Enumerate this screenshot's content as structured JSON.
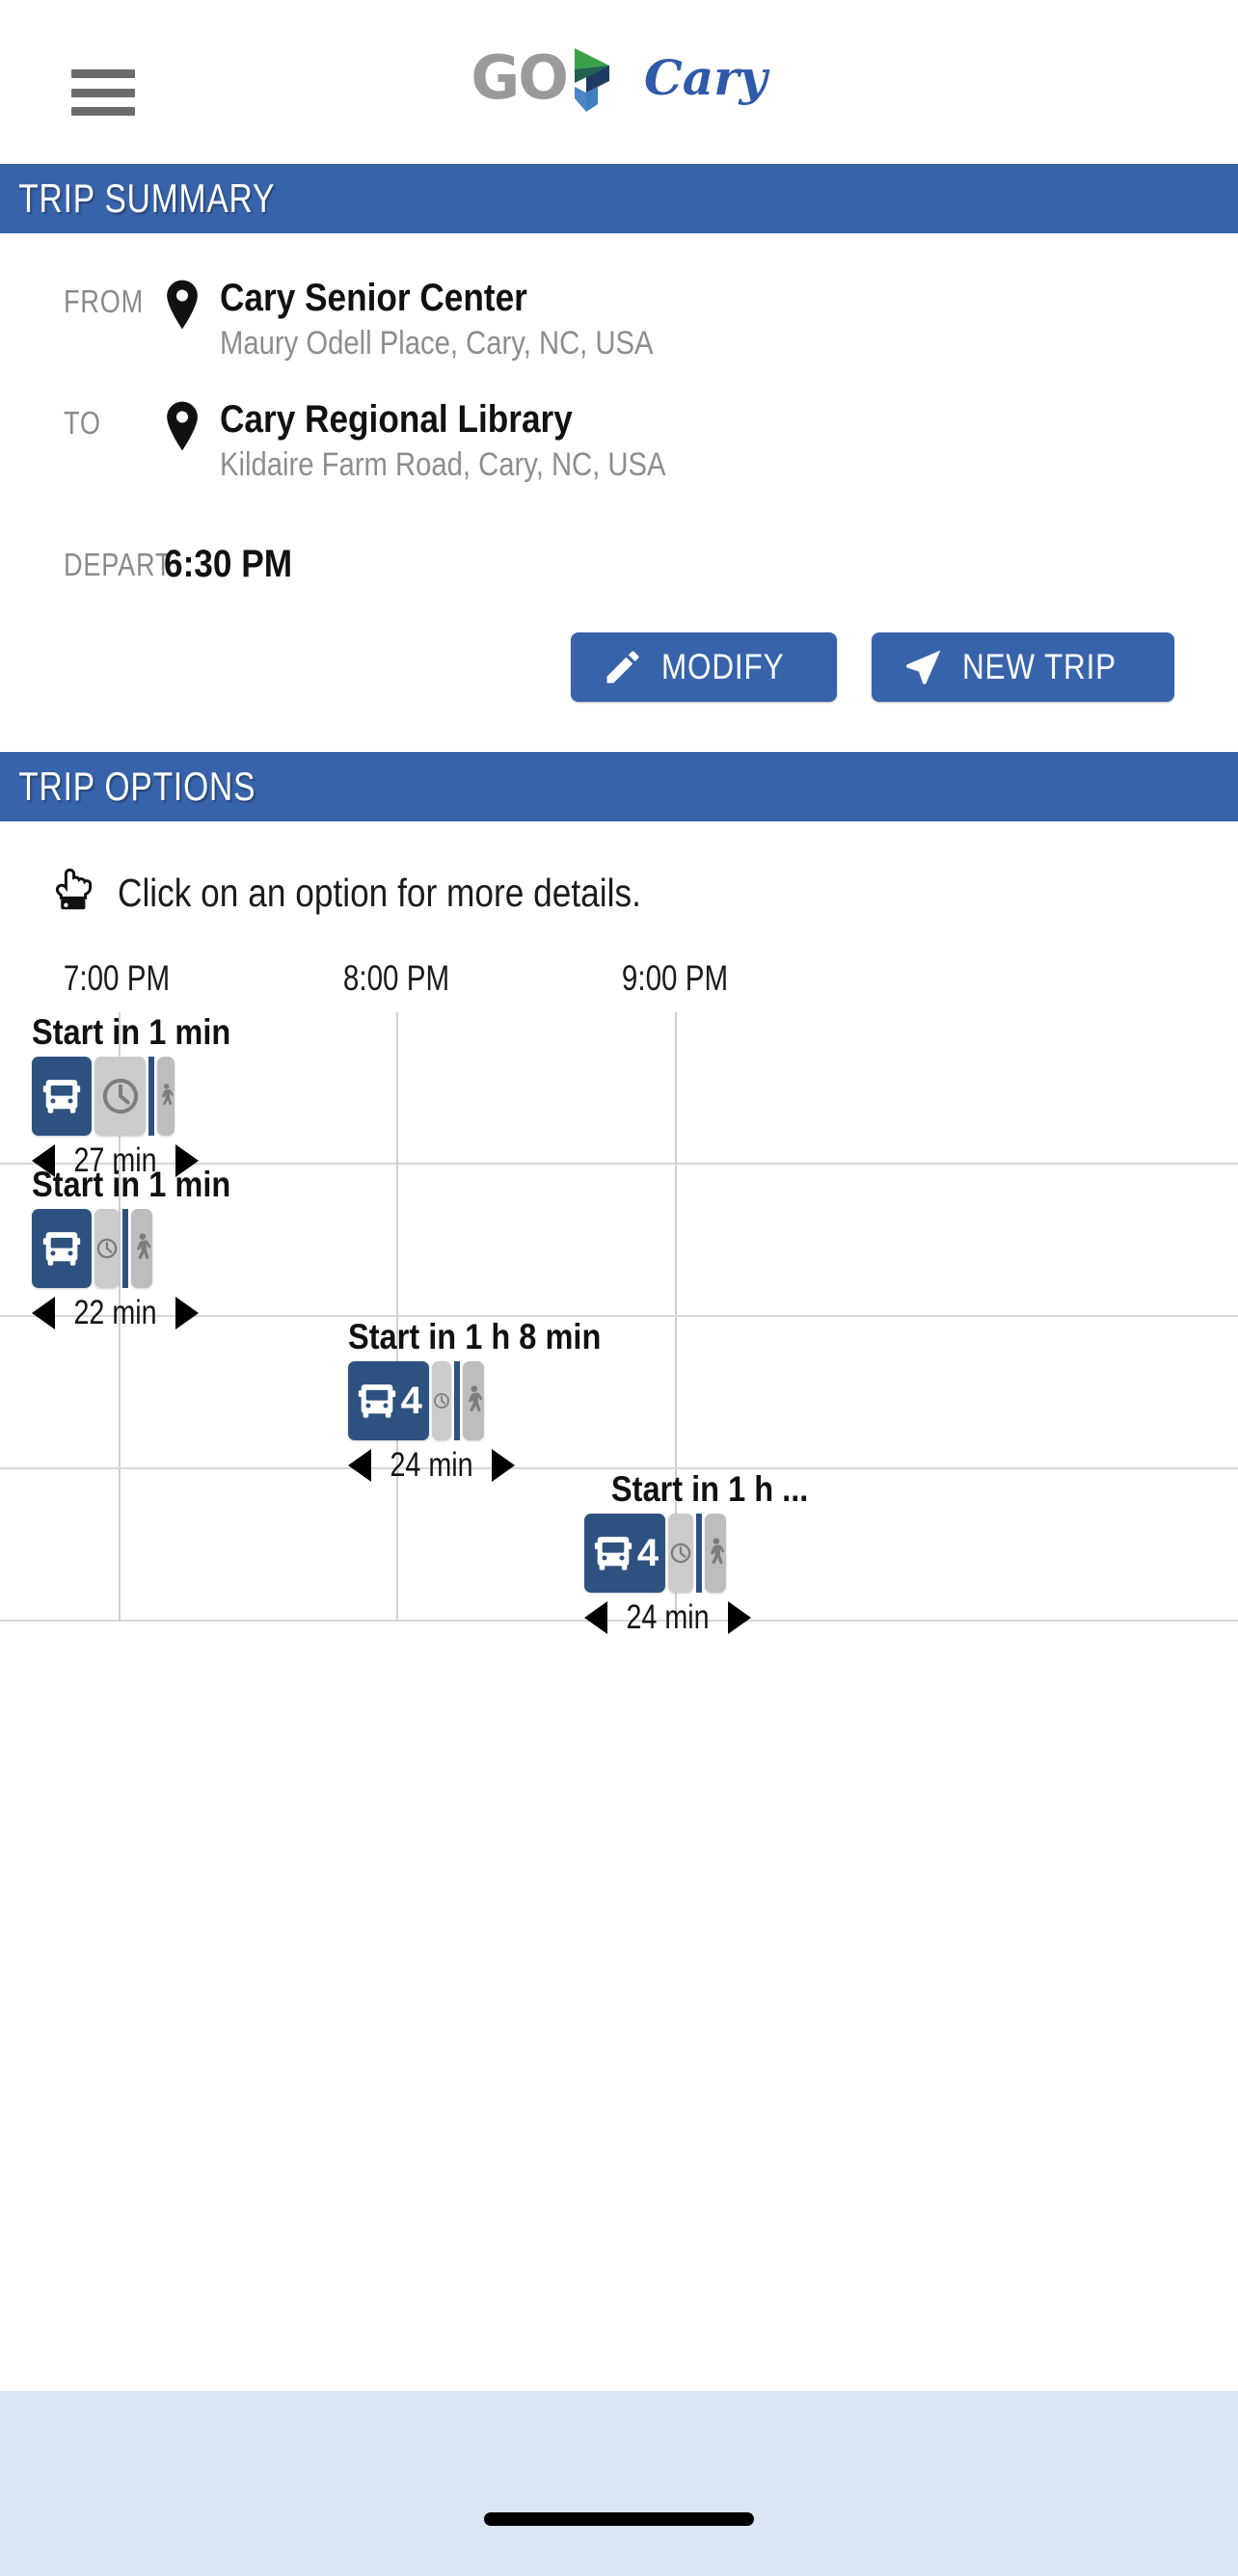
{
  "header": {
    "menu_icon": "hamburger-menu-icon",
    "logo_go": "GO",
    "logo_city": "Cary",
    "logo_mark_colors": {
      "green": "#3ba14a",
      "dark_teal": "#1f5b52",
      "navy": "#1f3a63",
      "mid_blue": "#2f5aa8",
      "light_blue": "#4a87c4"
    },
    "accent_color": "#3763ab"
  },
  "trip_summary": {
    "section_title": "TRIP SUMMARY",
    "from_label": "FROM",
    "from_name": "Cary Senior Center",
    "from_address": "Maury Odell Place, Cary, NC, USA",
    "to_label": "TO",
    "to_name": "Cary Regional Library",
    "to_address": "Kildaire Farm Road, Cary, NC, USA",
    "depart_label": "DEPART",
    "depart_value": "6:30 PM",
    "modify_button": "MODIFY",
    "modify_icon": "pencil-icon",
    "new_trip_button": "NEW TRIP",
    "new_trip_icon": "paper-plane-icon"
  },
  "trip_options": {
    "section_title": "TRIP OPTIONS",
    "hint_icon": "pointing-hand-icon",
    "hint_text": "Click on an option for more details.",
    "axis_ticks": [
      {
        "label": "7:00 PM",
        "x_pct": 9.4
      },
      {
        "label": "8:00 PM",
        "x_pct": 32.0
      },
      {
        "label": "9:00 PM",
        "x_pct": 54.5
      }
    ],
    "gridlines_x_pct": [
      9.6,
      32.0,
      54.5
    ],
    "options": [
      {
        "title": "Start in 1 min",
        "duration": "27 min",
        "left_pct": 2.6,
        "title_align": "left",
        "segments": [
          {
            "mode": "bus",
            "icon": "bus-icon",
            "width": 62,
            "route": ""
          },
          {
            "mode": "wait",
            "icon": "clock-icon",
            "width": 53
          },
          {
            "mode": "line",
            "icon": "",
            "width": 6
          },
          {
            "mode": "walk",
            "icon": "walk-icon",
            "width": 18
          }
        ]
      },
      {
        "title": "Start in 1 min",
        "duration": "22 min",
        "left_pct": 2.6,
        "title_align": "left",
        "segments": [
          {
            "mode": "bus",
            "icon": "bus-icon",
            "width": 62,
            "route": ""
          },
          {
            "mode": "wait",
            "icon": "clock-icon",
            "width": 26
          },
          {
            "mode": "line",
            "icon": "",
            "width": 6
          },
          {
            "mode": "walk",
            "icon": "walk-icon",
            "width": 22
          }
        ]
      },
      {
        "title": "Start in 1 h 8 min",
        "duration": "24 min",
        "left_pct": 28.1,
        "title_align": "left",
        "segments": [
          {
            "mode": "bus",
            "icon": "bus-icon",
            "width": 84,
            "route": "4"
          },
          {
            "mode": "wait",
            "icon": "clock-icon",
            "width": 20
          },
          {
            "mode": "line",
            "icon": "",
            "width": 6
          },
          {
            "mode": "walk",
            "icon": "walk-icon",
            "width": 22
          }
        ]
      },
      {
        "title": "Start in 1 h ...",
        "duration": "24 min",
        "left_pct": 47.2,
        "title_align": "right",
        "segments": [
          {
            "mode": "bus",
            "icon": "bus-icon",
            "width": 84,
            "route": "4"
          },
          {
            "mode": "wait",
            "icon": "clock-icon",
            "width": 26
          },
          {
            "mode": "line",
            "icon": "",
            "width": 6
          },
          {
            "mode": "walk",
            "icon": "walk-icon",
            "width": 22
          }
        ]
      }
    ]
  },
  "footer": {
    "home_indicator": "home-indicator-bar",
    "background_color": "#dce6f3"
  }
}
